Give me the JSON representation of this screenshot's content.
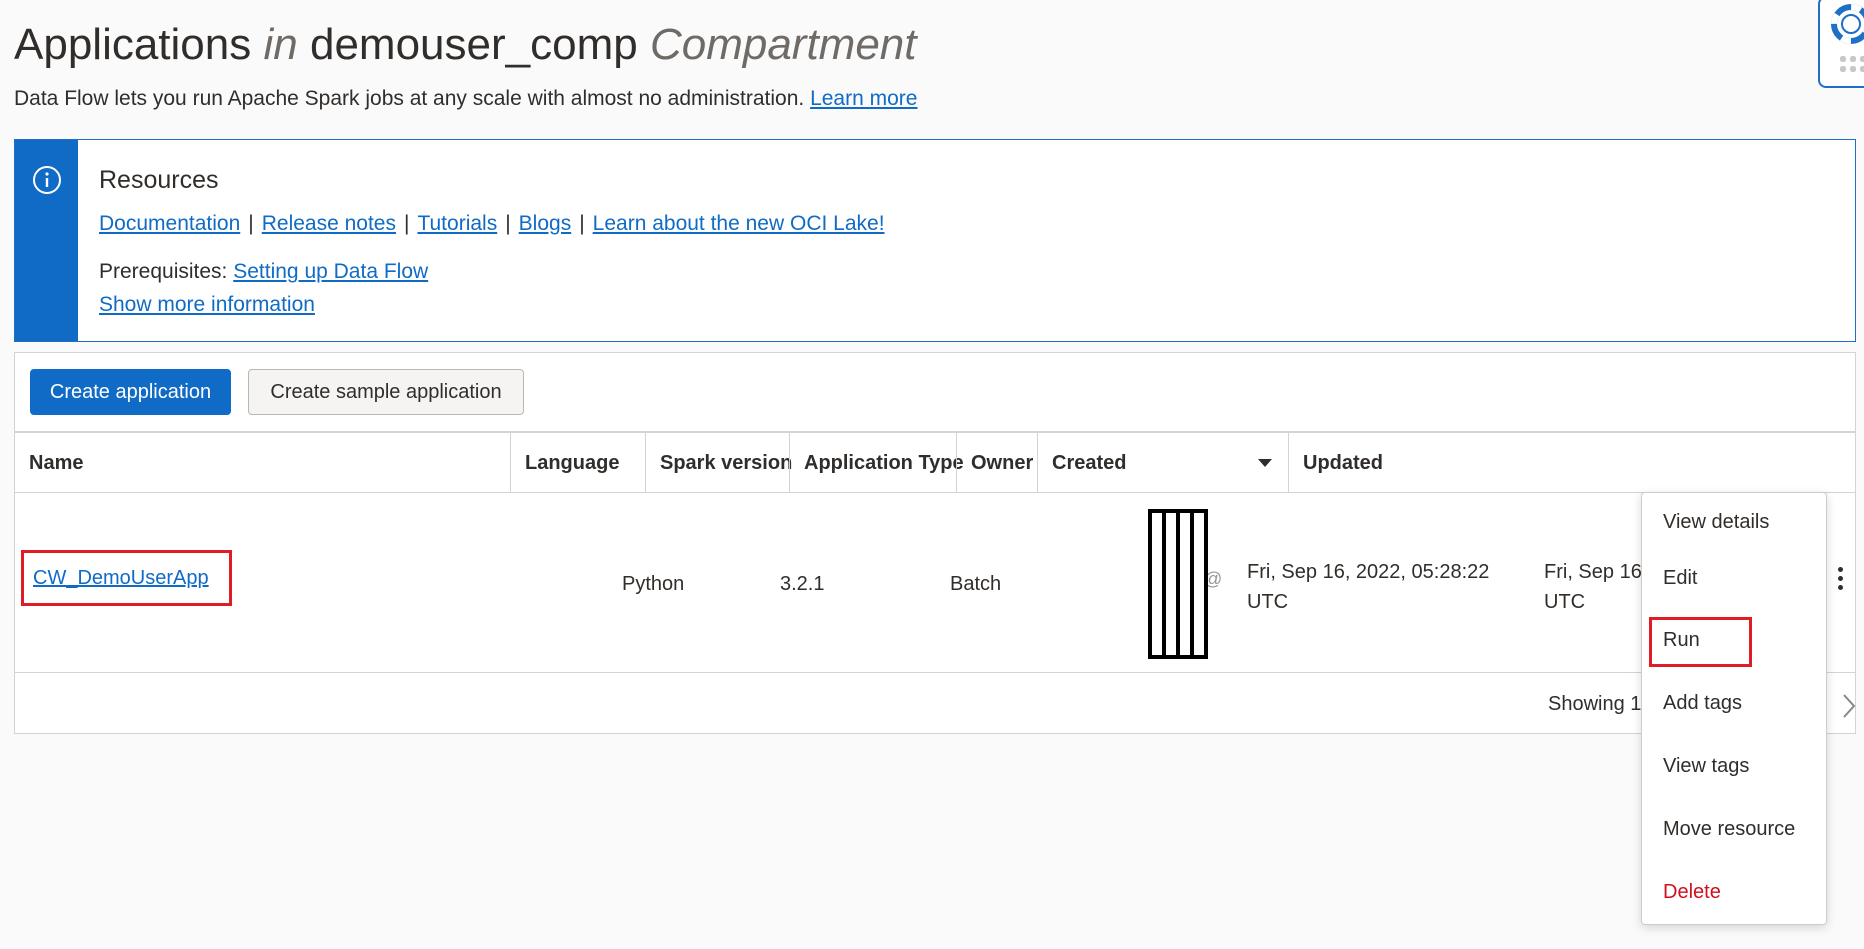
{
  "header": {
    "title_main": "Applications",
    "title_in": "in",
    "title_compartment": "demouser_comp",
    "title_suffix": "Compartment",
    "subtitle": "Data Flow lets you run Apache Spark jobs at any scale with almost no administration.",
    "learn_more": "Learn more"
  },
  "help_widget": {
    "icon": "lifebuoy-icon"
  },
  "resources": {
    "icon": "info-icon",
    "heading": "Resources",
    "links": [
      "Documentation",
      "Release notes",
      "Tutorials",
      "Blogs",
      "Learn about the new OCI Lake!"
    ],
    "separator": "|",
    "prerequisites_label": "Prerequisites:",
    "prerequisites_link": "Setting up Data Flow",
    "show_more": "Show more information"
  },
  "toolbar": {
    "create_application": "Create application",
    "create_sample_application": "Create sample application"
  },
  "table": {
    "columns": [
      "Name",
      "Language",
      "Spark version",
      "Application Type",
      "Owner",
      "Created",
      "Updated"
    ],
    "sorted_column": "Created",
    "rows": [
      {
        "name": "CW_DemoUserApp",
        "language": "Python",
        "spark_version": "3.2.1",
        "application_type": "Batch",
        "owner_partial": [
          "@",
          "."
        ],
        "created_line1": "Fri, Sep 16, 2022, 05:28:22",
        "created_line2": "UTC",
        "updated_line1": "Fri, Sep 16",
        "updated_line2": "UTC"
      }
    ],
    "footer_text": "Showing 1"
  },
  "actions_menu": {
    "items": [
      "View details",
      "Edit",
      "Run",
      "Add tags",
      "View tags",
      "Move resource",
      "Delete"
    ],
    "danger_item": "Delete",
    "highlighted_item": "Run"
  },
  "colors": {
    "primary": "#0f6bc6",
    "danger": "#d0101b",
    "highlight": "#e01c26"
  }
}
